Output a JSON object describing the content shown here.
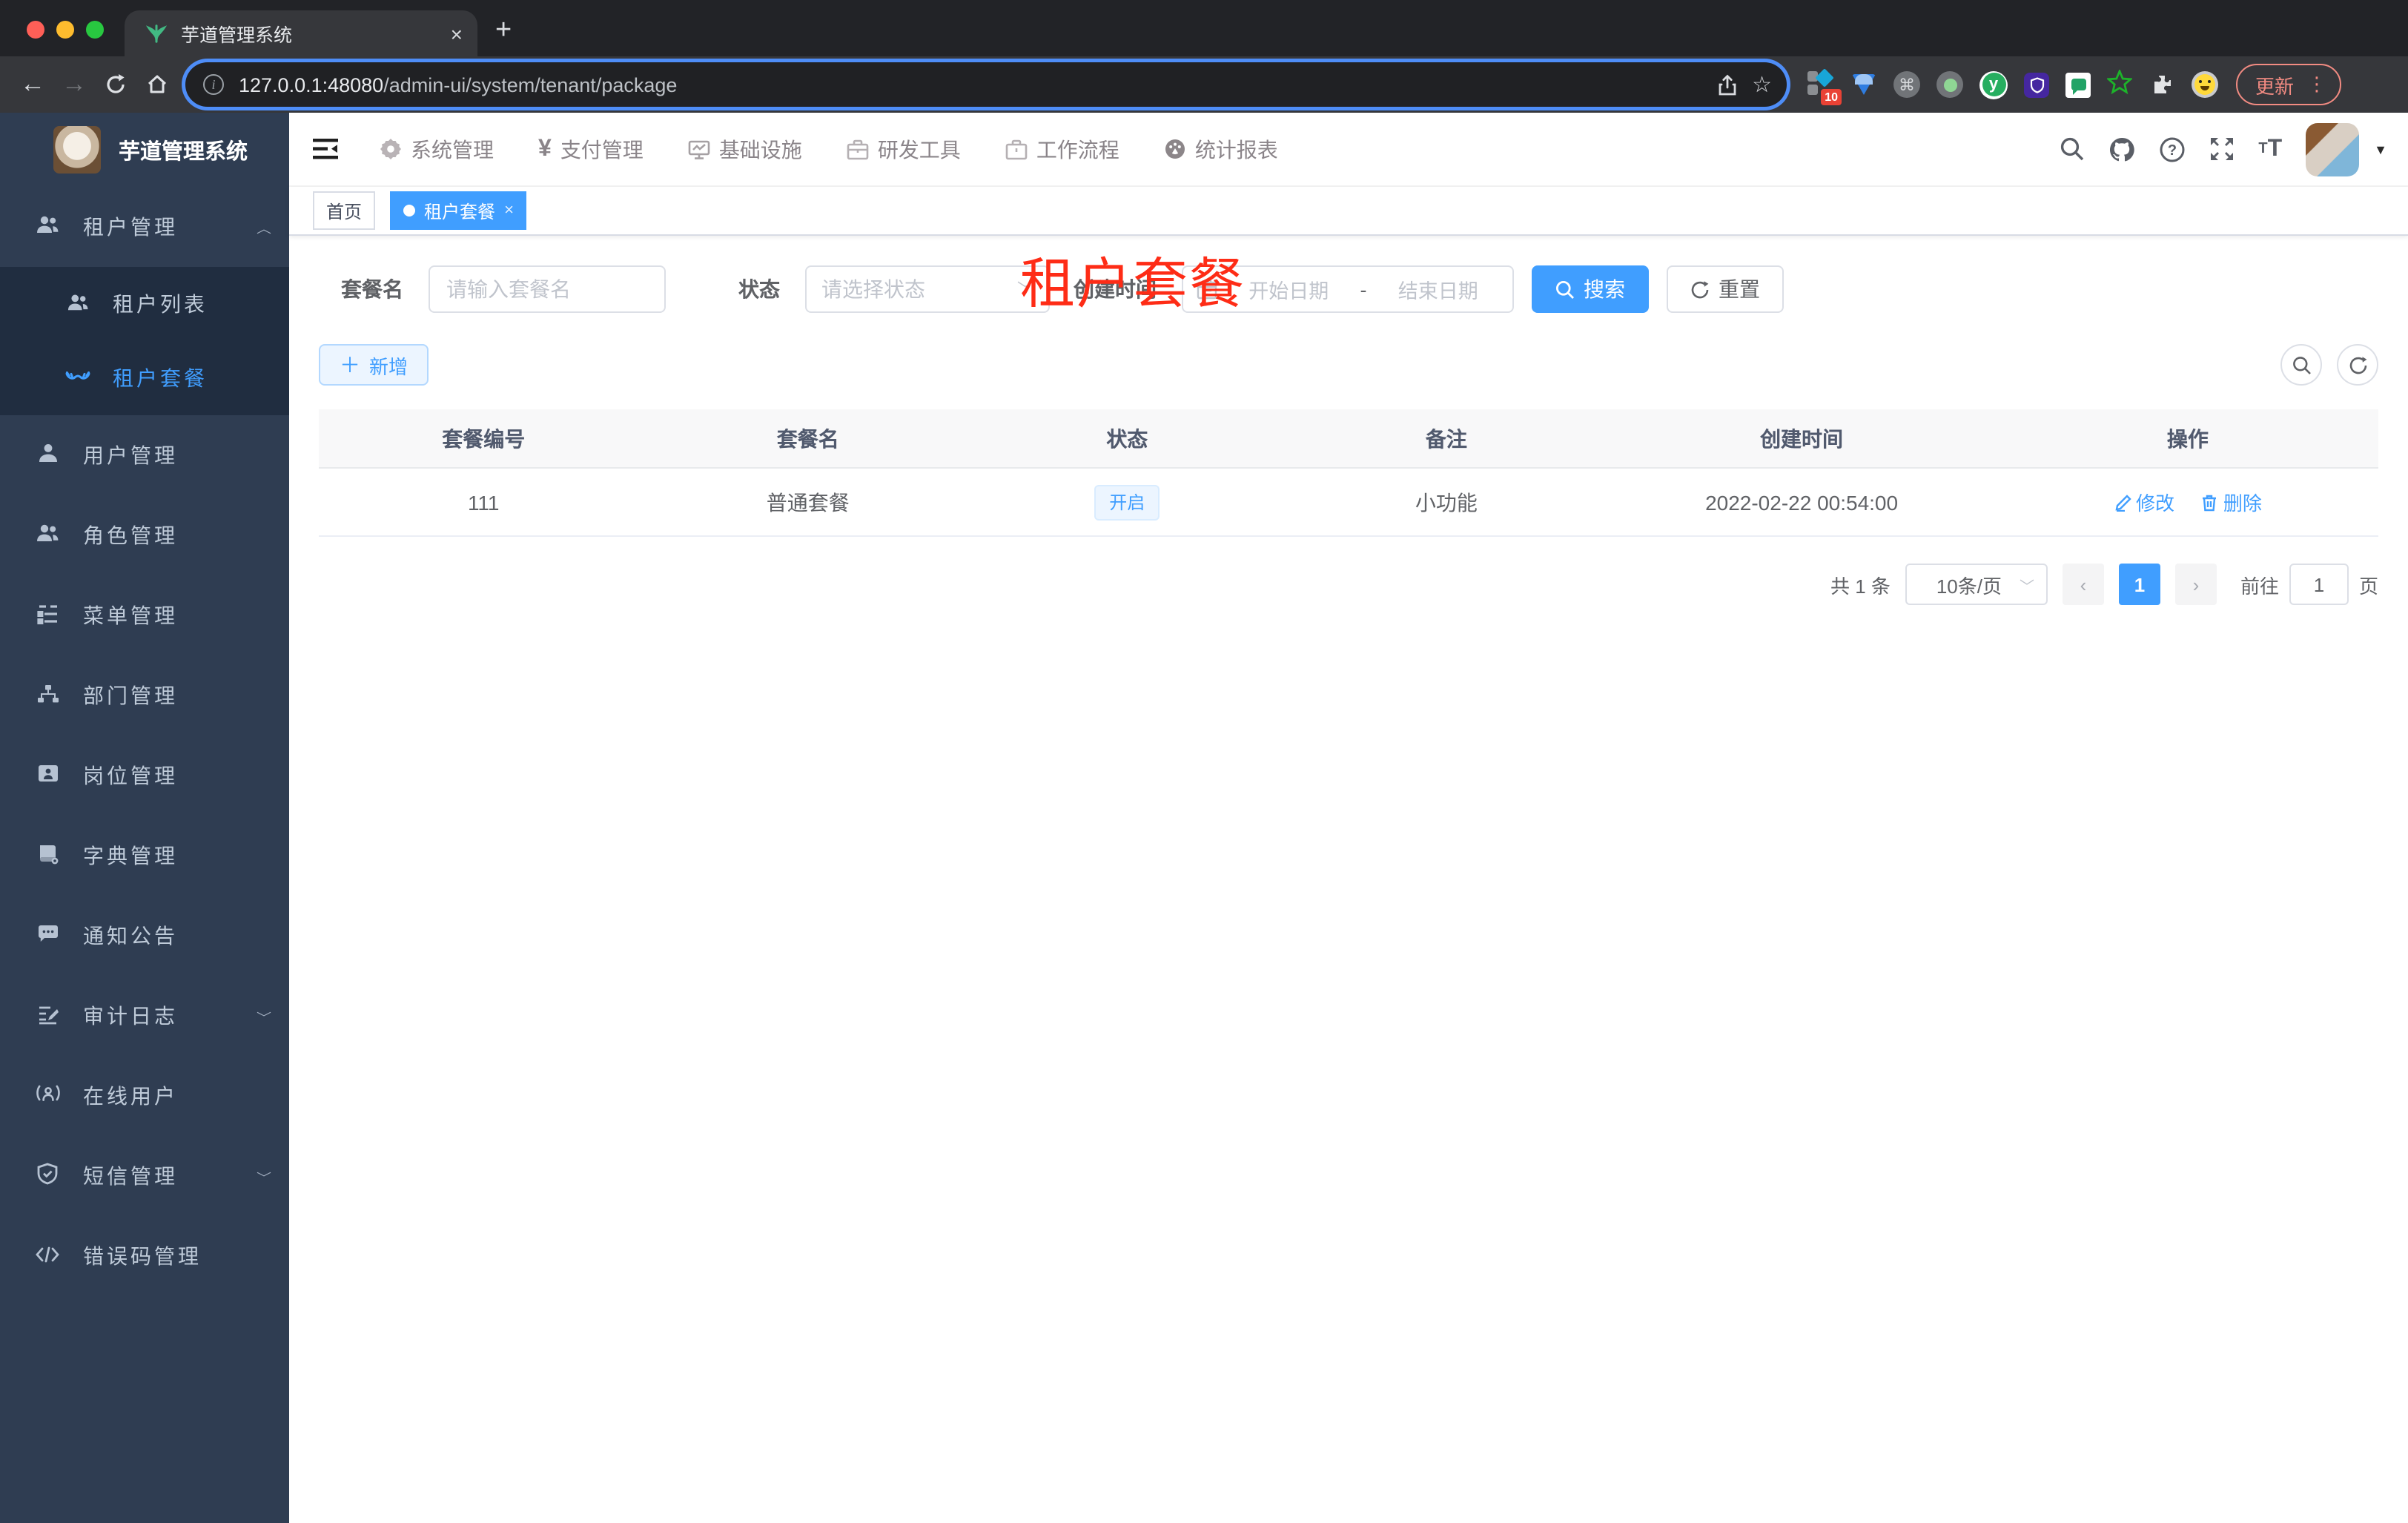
{
  "browser": {
    "tab_title": "芋道管理系统",
    "close_tab": "×",
    "new_tab": "+",
    "url_host": "127.0.0.1:48080",
    "url_path": "/admin-ui/system/tenant/package",
    "extension_badge": "10",
    "update_label": "更新"
  },
  "app": {
    "brand": "芋道管理系统",
    "top_nav": [
      {
        "label": "系统管理"
      },
      {
        "label": "支付管理"
      },
      {
        "label": "基础设施"
      },
      {
        "label": "研发工具"
      },
      {
        "label": "工作流程"
      },
      {
        "label": "统计报表"
      }
    ],
    "sidebar": {
      "parent": {
        "label": "租户管理"
      },
      "children": [
        {
          "label": "租户列表"
        },
        {
          "label": "租户套餐"
        }
      ],
      "items": [
        {
          "label": "用户管理"
        },
        {
          "label": "角色管理"
        },
        {
          "label": "菜单管理"
        },
        {
          "label": "部门管理"
        },
        {
          "label": "岗位管理"
        },
        {
          "label": "字典管理"
        },
        {
          "label": "通知公告"
        },
        {
          "label": "审计日志"
        },
        {
          "label": "在线用户"
        },
        {
          "label": "短信管理"
        },
        {
          "label": "错误码管理"
        }
      ]
    },
    "tags": {
      "home": "首页",
      "active": "租户套餐"
    },
    "annotation": "租户套餐",
    "filters": {
      "name_label": "套餐名",
      "name_placeholder": "请输入套餐名",
      "status_label": "状态",
      "status_placeholder": "请选择状态",
      "time_label": "创建时间",
      "start_placeholder": "开始日期",
      "range_separator": "-",
      "end_placeholder": "结束日期",
      "search_label": "搜索",
      "reset_label": "重置"
    },
    "toolbar": {
      "add_label": "新增"
    },
    "table": {
      "headers": [
        "套餐编号",
        "套餐名",
        "状态",
        "备注",
        "创建时间",
        "操作"
      ],
      "rows": [
        {
          "id": "111",
          "name": "普通套餐",
          "status": "开启",
          "remark": "小功能",
          "created": "2022-02-22 00:54:00",
          "edit_label": "修改",
          "delete_label": "删除"
        }
      ]
    },
    "pagination": {
      "total": "共 1 条",
      "page_size": "10条/页",
      "page": "1",
      "goto_label": "前往",
      "goto_value": "1",
      "unit_label": "页"
    }
  },
  "colors": {
    "accent": "#409eff",
    "sidebar_bg": "#2f3d52",
    "submenu_bg": "#202d40",
    "annotation_red": "#fe2c16",
    "chrome_dark": "#222327",
    "toolbar_dark": "#36373b"
  }
}
